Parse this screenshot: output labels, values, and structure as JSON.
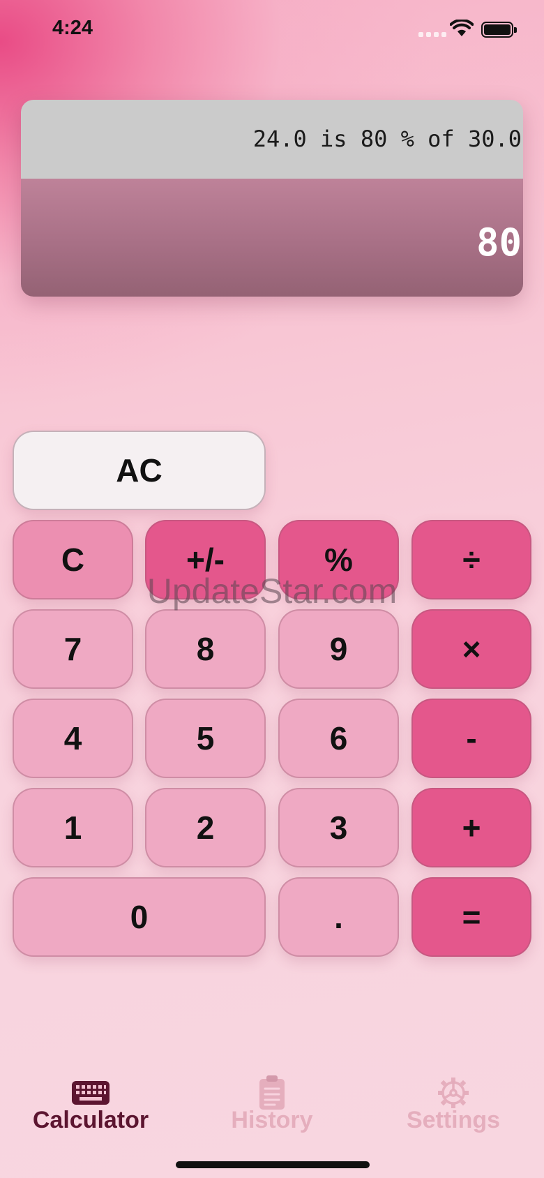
{
  "status_bar": {
    "time": "4:24"
  },
  "display": {
    "expression": "24.0 is 80 % of 30.0",
    "result": "80"
  },
  "keypad": {
    "ac": "AC",
    "c": "C",
    "sign": "+/-",
    "percent": "%",
    "divide": "÷",
    "seven": "7",
    "eight": "8",
    "nine": "9",
    "multiply": "×",
    "four": "4",
    "five": "5",
    "six": "6",
    "minus": "-",
    "one": "1",
    "two": "2",
    "three": "3",
    "plus": "+",
    "zero": "0",
    "decimal": ".",
    "equals": "="
  },
  "watermark": "UpdateStar.com",
  "tabs": [
    {
      "label": "Calculator",
      "icon": "keyboard-icon",
      "active": true
    },
    {
      "label": "History",
      "icon": "clipboard-icon",
      "active": false
    },
    {
      "label": "Settings",
      "icon": "gear-icon",
      "active": false
    }
  ],
  "colors": {
    "number_key": "#efa9c3",
    "function_key": "#ec8fb1",
    "operator_key": "#e4578c",
    "clear_key": "#f5f0f2",
    "active_tab": "#5c1530"
  }
}
